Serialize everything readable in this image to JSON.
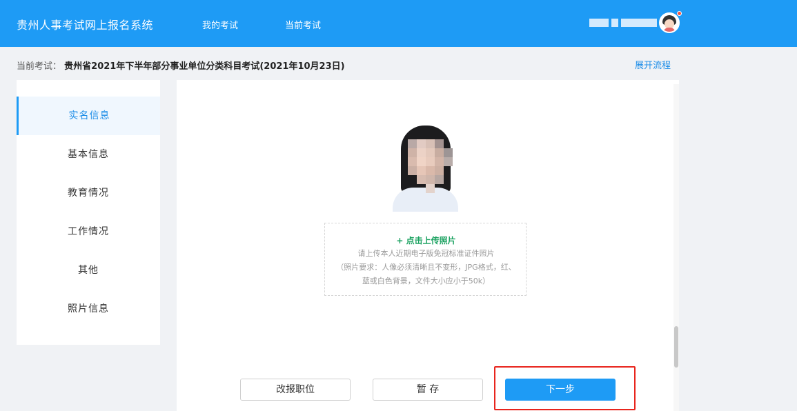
{
  "header": {
    "title": "贵州人事考试网上报名系统",
    "nav": [
      "我的考试",
      "当前考试"
    ],
    "user_name_blurred": true
  },
  "current_exam": {
    "label": "当前考试：",
    "name": "贵州省2021年下半年部分事业单位分类科目考试(2021年10月23日)",
    "expand_link": "展开流程"
  },
  "sidebar": {
    "items": [
      {
        "label": "实名信息",
        "active": true
      },
      {
        "label": "基本信息",
        "active": false
      },
      {
        "label": "教育情况",
        "active": false
      },
      {
        "label": "工作情况",
        "active": false
      },
      {
        "label": "其他",
        "active": false
      },
      {
        "label": "照片信息",
        "active": false
      }
    ]
  },
  "upload": {
    "title": "+ 点击上传照片",
    "desc_line1": "请上传本人近期电子版免冠标准证件照片",
    "desc_line2": "（照片要求：人像必须清晰且不变形，JPG格式，红、",
    "desc_line3": "蓝或白色背景，文件大小应小于50k）"
  },
  "buttons": {
    "change_position": "改报职位",
    "save_draft": "暂 存",
    "next": "下一步"
  },
  "colors": {
    "header": "#1e9bf5",
    "accent": "#1e8ee8",
    "upload_title": "#19a15f",
    "highlight": "#e8251d"
  }
}
